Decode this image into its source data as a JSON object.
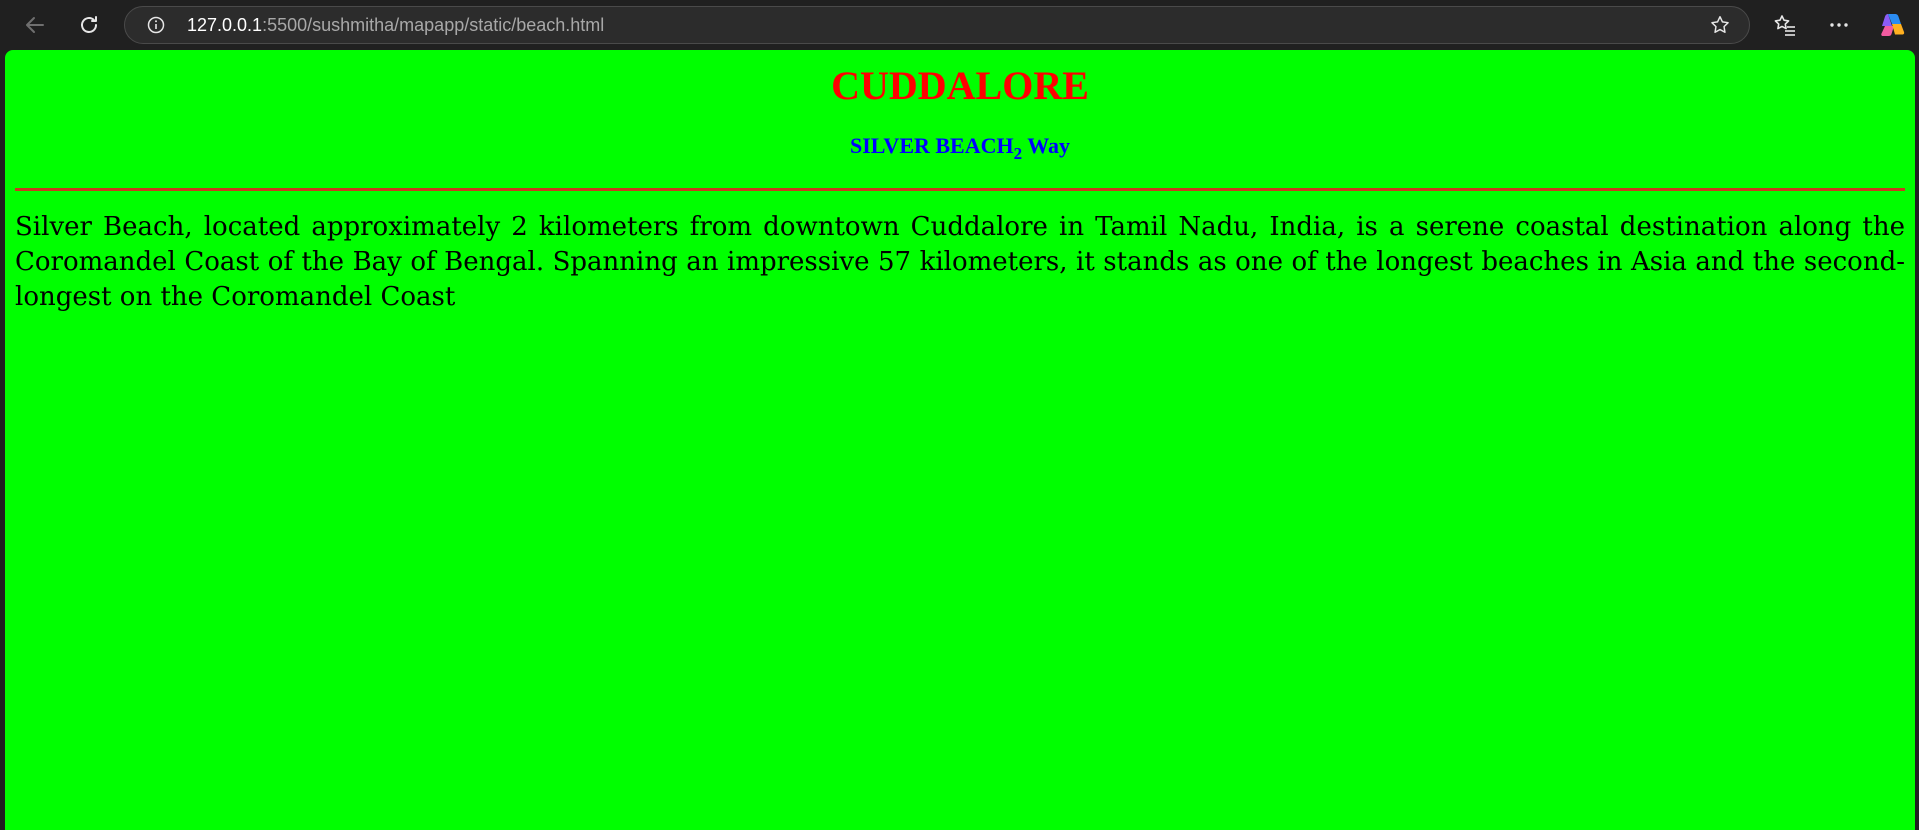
{
  "browser": {
    "url_host": "127.0.0.1",
    "url_path": ":5500/sushmitha/mapapp/static/beach.html",
    "icons": {
      "back": "back-arrow-icon",
      "reload": "reload-icon",
      "info": "info-icon",
      "favorite": "star-icon",
      "favorites": "favorites-icon",
      "more": "more-icon",
      "copilot": "copilot-icon"
    }
  },
  "page": {
    "title": "CUDDALORE",
    "subtitle_main": "SILVER BEACH",
    "subtitle_sub": "2",
    "subtitle_end": " Way",
    "description": "Silver Beach, located approximately 2 kilometers from downtown Cuddalore in Tamil Nadu, India, is a serene coastal destination along the Coromandel Coast of the Bay of Bengal. Spanning an impressive 57 kilometers, it stands as one of the longest beaches in Asia and the second-longest on the Coromandel Coast",
    "colors": {
      "background": "#00ff00",
      "title": "#ff0000",
      "subtitle": "#0000ff",
      "divider": "#c83a1e",
      "text": "#000000"
    }
  }
}
